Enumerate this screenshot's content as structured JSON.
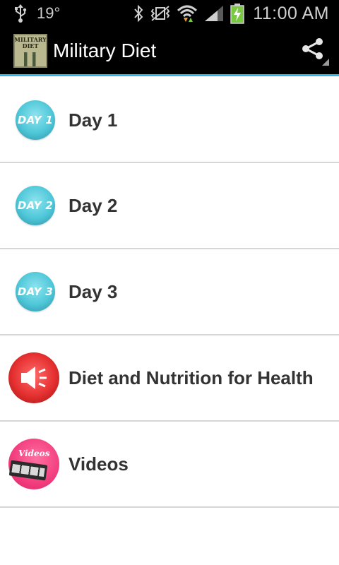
{
  "status_bar": {
    "temperature": "19°",
    "time": "11:00 AM",
    "icons": [
      "usb-icon",
      "bluetooth-icon",
      "vibrate-icon",
      "wifi-icon",
      "signal-icon",
      "battery-charging-icon"
    ]
  },
  "action_bar": {
    "title": "Military Diet",
    "logo_text": "MILITARY DIET",
    "share_icon": "share-icon",
    "accent_color": "#33b5e5"
  },
  "menu": {
    "items": [
      {
        "label": "Day 1",
        "icon": "day-1-icon",
        "icon_text": "DAY 1"
      },
      {
        "label": "Day 2",
        "icon": "day-2-icon",
        "icon_text": "DAY 2"
      },
      {
        "label": "Day 3",
        "icon": "day-3-icon",
        "icon_text": "DAY 3"
      },
      {
        "label": "Diet and Nutrition for Health",
        "icon": "speaker-icon"
      },
      {
        "label": "Videos",
        "icon": "videos-icon",
        "icon_text": "Videos"
      }
    ]
  }
}
